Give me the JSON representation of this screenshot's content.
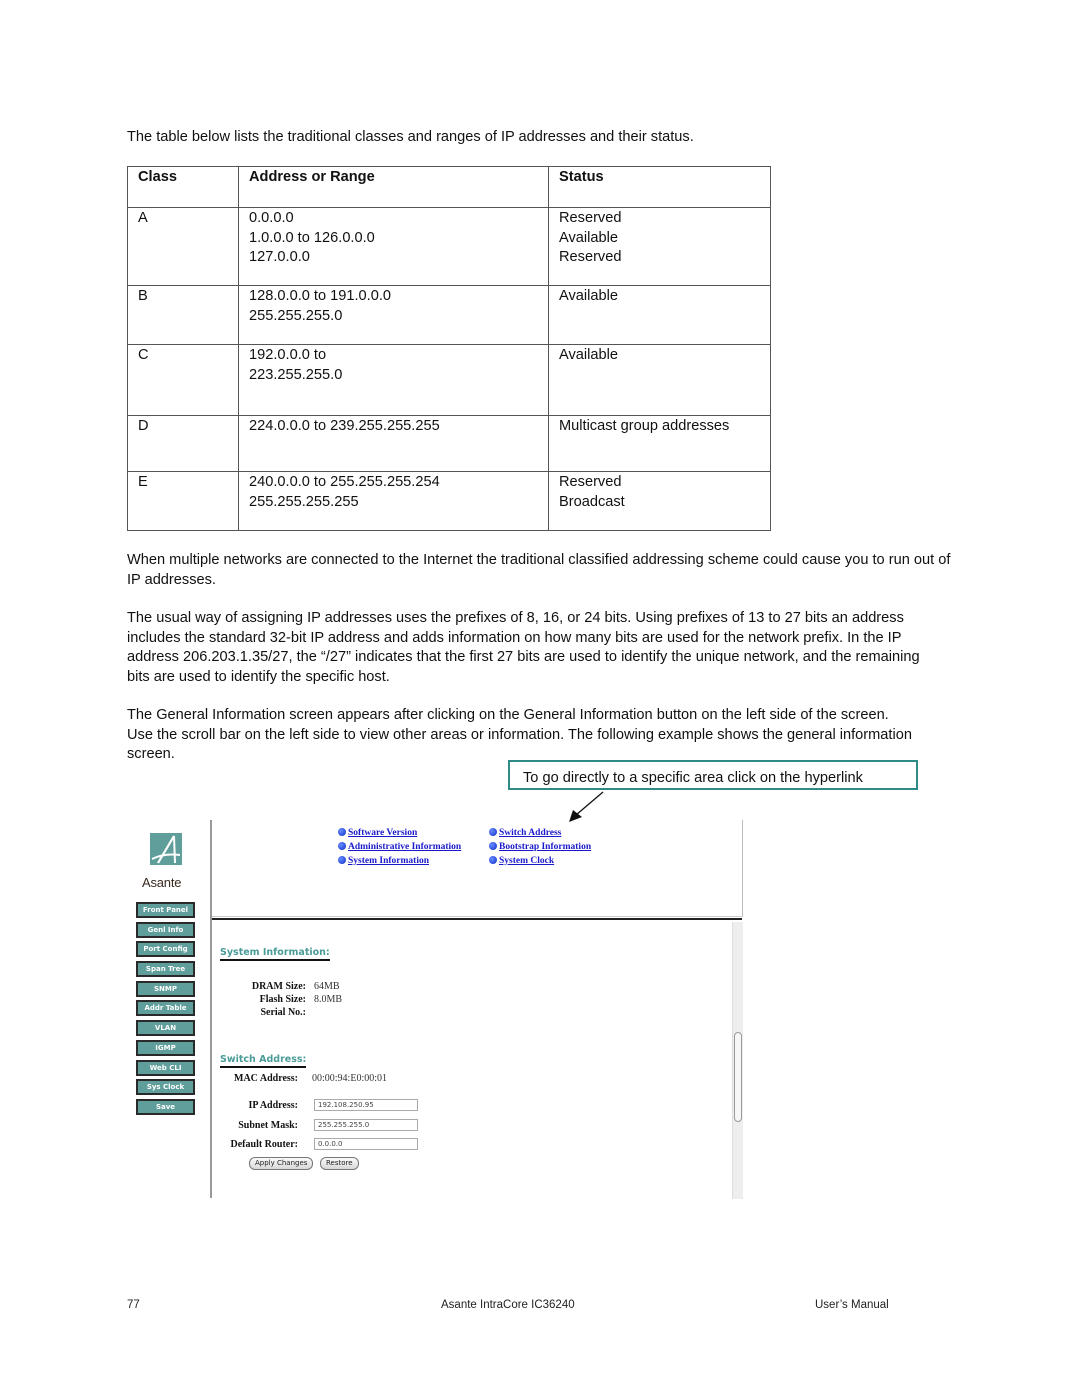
{
  "intro": "The table below lists the traditional classes and ranges of IP addresses and their status.",
  "table": {
    "headers": [
      "Class",
      "Address or Range",
      "Status"
    ],
    "rows": [
      {
        "class": "A",
        "address": [
          "0.0.0.0",
          "1.0.0.0 to 126.0.0.0",
          "127.0.0.0"
        ],
        "status": [
          "Reserved",
          "Available",
          "Reserved"
        ]
      },
      {
        "class": "B",
        "address": [
          "128.0.0.0 to 191.0.0.0",
          "255.255.255.0"
        ],
        "status": [
          "Available"
        ]
      },
      {
        "class": "C",
        "address": [
          "192.0.0.0 to",
          "223.255.255.0"
        ],
        "status": [
          "Available"
        ]
      },
      {
        "class": "D",
        "address": [
          "224.0.0.0 to 239.255.255.255"
        ],
        "status": [
          "Multicast group addresses"
        ]
      },
      {
        "class": "E",
        "address": [
          "240.0.0.0 to 255.255.255.254",
          "255.255.255.255"
        ],
        "status": [
          "Reserved",
          "Broadcast"
        ]
      }
    ]
  },
  "paragraphs": [
    "When multiple networks are connected to the Internet the traditional classified addressing scheme could cause you to run out of IP addresses.",
    "The usual way of assigning IP addresses uses the prefixes of 8, 16, or 24 bits. Using prefixes of 13 to 27 bits an address includes the standard 32-bit IP address and adds information on how many bits are used for the network prefix. In the IP address 206.203.1.35/27, the “/27” indicates that the first 27 bits are used to identify the unique network, and the remaining bits are used to identify the specific host.",
    "The General Information screen appears after clicking on the General Information button on the left side of the screen. Use the scroll bar on the left side to view other areas or information. The following example shows the general information screen."
  ],
  "callout": "To go directly to a specific area click on the hyperlink",
  "screenshot": {
    "logo_text": "Asante",
    "nav_buttons": [
      "Front Panel",
      "Genl Info",
      "Port Config",
      "Span Tree",
      "SNMP",
      "Addr Table",
      "VLAN",
      "IGMP",
      "Web CLI",
      "Sys Clock",
      "Save"
    ],
    "links_left": [
      "Software Version",
      "Administrative Information",
      "System Information"
    ],
    "links_right": [
      "Switch Address",
      "Bootstrap Information",
      "System Clock"
    ],
    "system_info": {
      "title": "System Information:",
      "dram_label": "DRAM Size:",
      "dram_value": "64MB",
      "flash_label": "Flash Size:",
      "flash_value": "8.0MB",
      "serial_label": "Serial No.:",
      "serial_value": ""
    },
    "switch_address": {
      "title": "Switch Address:",
      "mac_label": "MAC Address:",
      "mac_value": "00:00:94:E0:00:01",
      "ip_label": "IP Address:",
      "ip_value": "192.108.250.95",
      "mask_label": "Subnet Mask:",
      "mask_value": "255.255.255.0",
      "router_label": "Default Router:",
      "router_value": "0.0.0.0",
      "apply_label": "Apply Changes",
      "restore_label": "Restore"
    }
  },
  "footer": {
    "page_number": "77",
    "product": "Asante IntraCore IC36240",
    "manual": "User’s Manual"
  }
}
